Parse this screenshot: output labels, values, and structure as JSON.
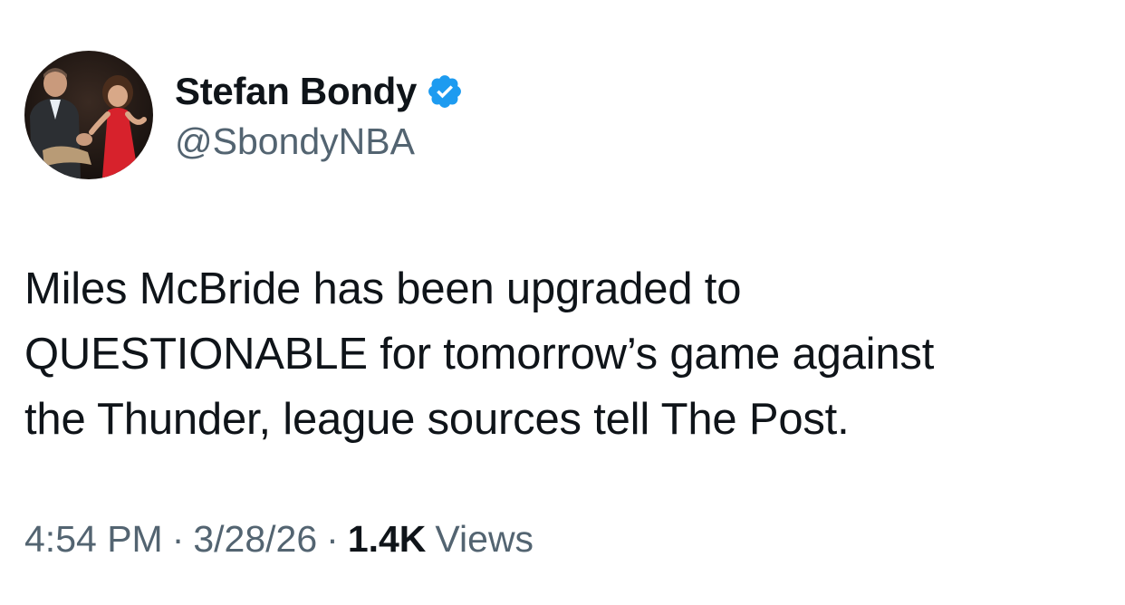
{
  "author": {
    "display_name": "Stefan Bondy",
    "handle": "@SbondyNBA",
    "verified": true,
    "verified_icon": "verified-badge-icon",
    "verified_color": "#1d9bf0"
  },
  "tweet": {
    "text_lines": [
      "Miles McBride has been upgraded to",
      "QUESTIONABLE for tomorrow’s game against",
      "the Thunder, league sources tell The Post."
    ]
  },
  "meta": {
    "time": "4:54 PM",
    "separator": "·",
    "date": "3/28/26",
    "views_count": "1.4K",
    "views_label": "Views"
  },
  "colors": {
    "text_primary": "#0f1419",
    "text_secondary": "#536471",
    "background": "#ffffff"
  }
}
